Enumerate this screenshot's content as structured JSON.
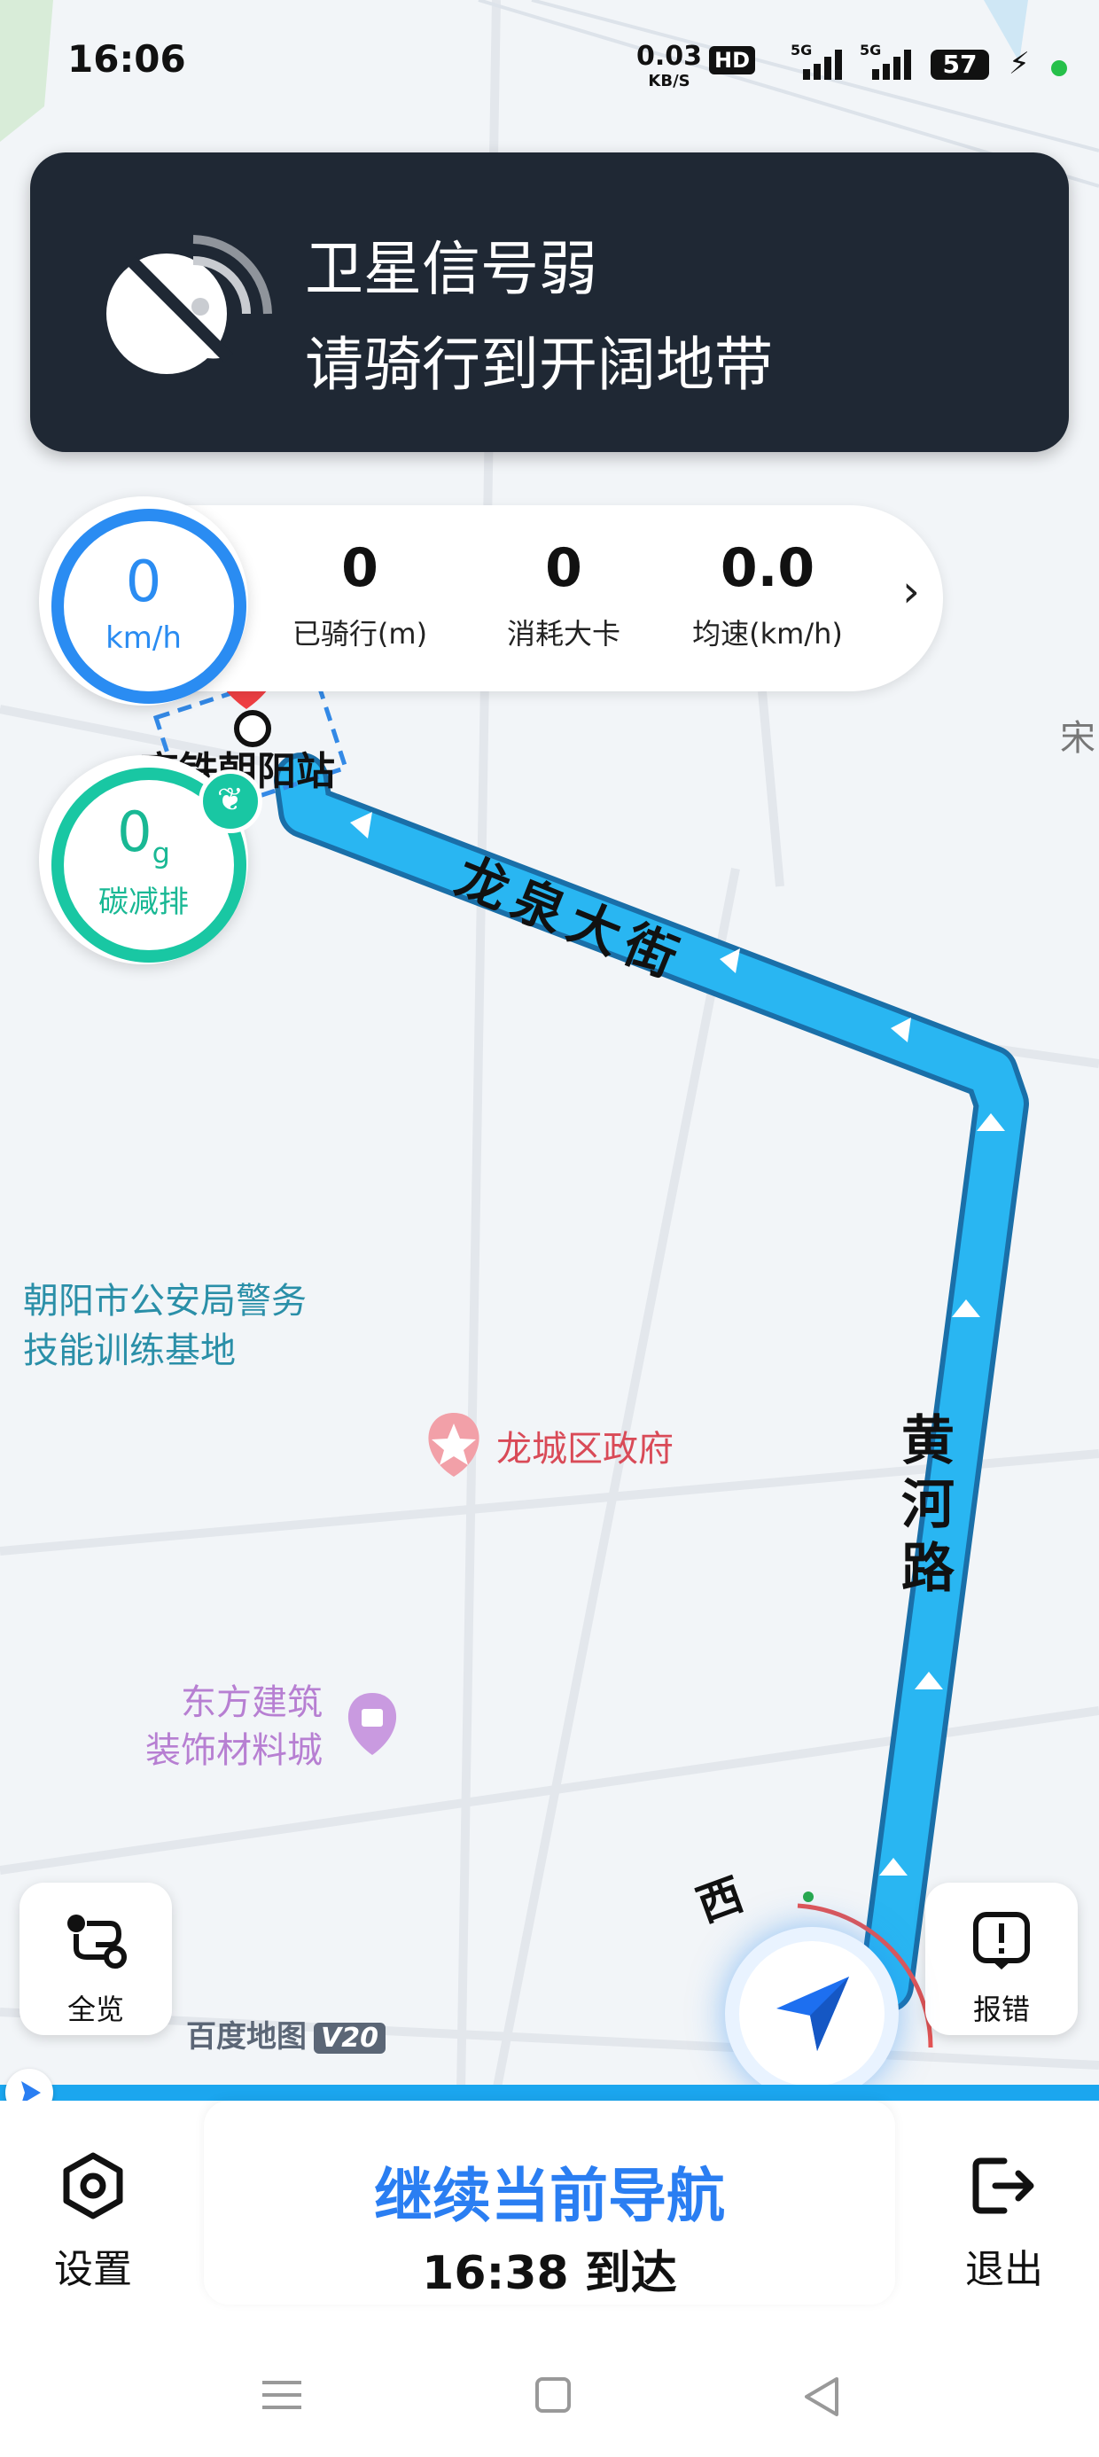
{
  "status_bar": {
    "time": "16:06",
    "net_speed": "0.03",
    "net_unit": "KB/S",
    "hd": "HD",
    "sig1": "5G",
    "sig2": "5G",
    "battery": "57"
  },
  "alert": {
    "title": "卫星信号弱",
    "message": "请骑行到开阔地带",
    "icon": "weak-satellite-icon"
  },
  "speed": {
    "value": "0",
    "unit": "km/h"
  },
  "stats": [
    {
      "value": "0",
      "label": "已骑行(m)"
    },
    {
      "value": "0",
      "label": "消耗大卡"
    },
    {
      "value": "0.0",
      "label": "均速(km/h)"
    }
  ],
  "carbon": {
    "value": "0",
    "unit": "g",
    "label": "碳减排"
  },
  "map": {
    "station": "高铁朝阳站",
    "road_longquan": "龙泉大街",
    "road_huanghe": "黄河路",
    "poi_police_line1": "朝阳市公安局警务",
    "poi_police_line2": "技能训练基地",
    "poi_gov": "龙城区政府",
    "poi_dongfang_line1": "东方建筑",
    "poi_dongfang_line2": "装饰材料城",
    "song": "宋",
    "xi": "西",
    "watermark": "百度地图",
    "watermark_version": "V20",
    "route_color": "#29b6f2"
  },
  "buttons": {
    "overview": "全览",
    "report": "报错"
  },
  "bottom": {
    "settings": "设置",
    "continue": "继续当前导航",
    "eta": "16:38 到达",
    "exit": "退出"
  }
}
